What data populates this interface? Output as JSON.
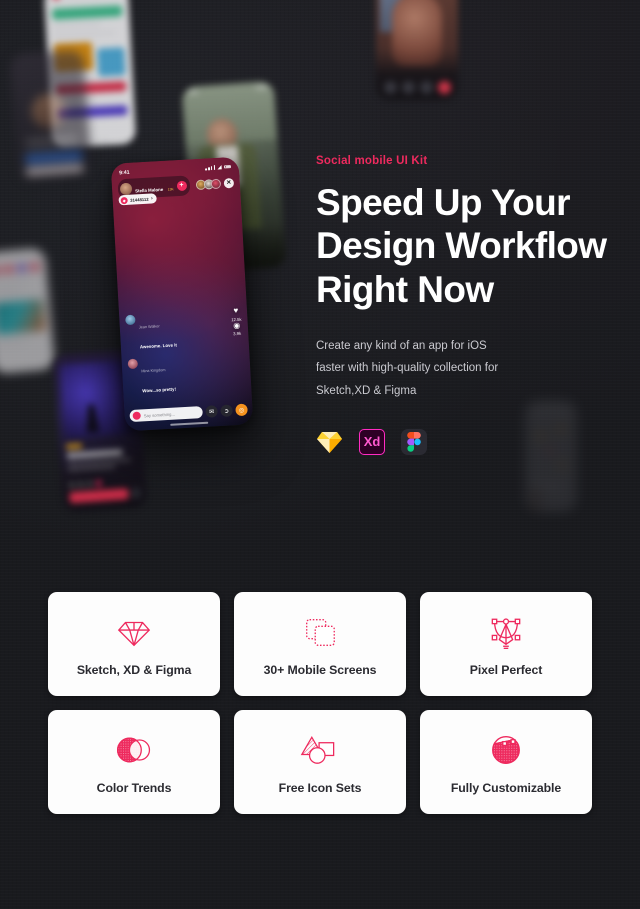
{
  "theme": {
    "background": "#191a1e",
    "accent": "#ee2a5e",
    "card_bg": "#fdfdfd",
    "heading_color": "#ffffff",
    "body_color": "#c9c9cf"
  },
  "hero": {
    "eyebrow": "Social mobile UI Kit",
    "headline_line1": "Speed Up Your",
    "headline_line2": "Design Workflow",
    "headline_line3": "Right Now",
    "subcopy_line1": "Create any kind of an app for iOS",
    "subcopy_line2": "faster with high-quality collection for",
    "subcopy_line3": "Sketch,XD & Figma",
    "logos": [
      {
        "name": "sketch-logo",
        "label": "Sketch"
      },
      {
        "name": "adobe-xd-logo",
        "label": "Xd"
      },
      {
        "name": "figma-logo",
        "label": "Figma"
      }
    ]
  },
  "phone_mockup": {
    "status_time": "9:41",
    "host_name": "Stella Malone",
    "host_sub": "13K",
    "follow_label": "+",
    "close_label": "✕",
    "viewer_count": "31448112",
    "viewer_chevron": "›",
    "stats": [
      {
        "icon": "heart-icon",
        "glyph": "♥",
        "value": "12.5k"
      },
      {
        "icon": "eye-icon",
        "glyph": "◉",
        "value": "3.9k"
      }
    ],
    "comments": [
      {
        "name": "Jean Walker",
        "message": "Awesome. Love it"
      },
      {
        "name": "Mina Kingdom",
        "message": "Wow...so pretty!"
      }
    ],
    "input_placeholder": "Say something...",
    "actions": [
      {
        "name": "gift-button",
        "glyph": "✉"
      },
      {
        "name": "share-button",
        "glyph": "➲"
      },
      {
        "name": "coins-button",
        "glyph": "◎"
      }
    ]
  },
  "features": [
    {
      "id": "sketch-xd-figma",
      "icon": "diamond-icon",
      "label": "Sketch, XD & Figma"
    },
    {
      "id": "mobile-screens",
      "icon": "screens-icon",
      "label": "30+ Mobile Screens"
    },
    {
      "id": "pixel-perfect",
      "icon": "pen-tool-icon",
      "label": "Pixel Perfect"
    },
    {
      "id": "color-trends",
      "icon": "color-circles-icon",
      "label": "Color Trends"
    },
    {
      "id": "free-icon-sets",
      "icon": "shapes-icon",
      "label": "Free Icon Sets"
    },
    {
      "id": "fully-customizable",
      "icon": "customize-circle-icon",
      "label": "Fully Customizable"
    }
  ]
}
